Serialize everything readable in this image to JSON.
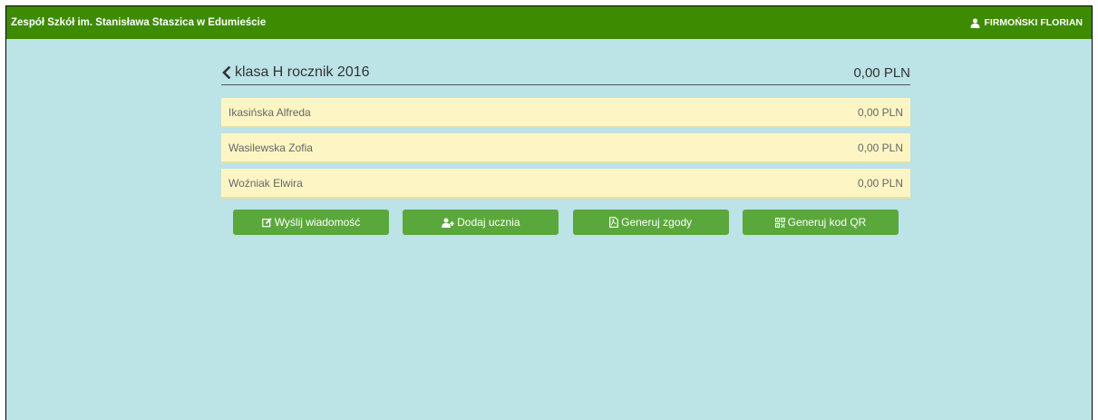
{
  "topbar": {
    "school_name": "Zespół Szkół im. Stanisława Staszica w Edumieście",
    "user_name": "FIRMOŃSKI FLORIAN"
  },
  "class_view": {
    "title": "klasa H rocznik 2016",
    "total": "0,00 PLN"
  },
  "students": [
    {
      "name": "Ikasińska Alfreda",
      "amount": "0,00 PLN"
    },
    {
      "name": "Wasilewska Zofia",
      "amount": "0,00 PLN"
    },
    {
      "name": "Woźniak Elwira",
      "amount": "0,00 PLN"
    }
  ],
  "actions": {
    "send_message": "Wyślij wiadomość",
    "add_student": "Dodaj ucznia",
    "generate_consents": "Generuj zgody",
    "generate_qr": "Generuj kod QR"
  },
  "colors": {
    "topbar": "#3d8b00",
    "background": "#bce3e6",
    "row": "#fdf6c4",
    "button": "#5aa83b"
  },
  "icons": {
    "user": "user-icon",
    "back": "chevron-left-icon",
    "send_message": "edit-icon",
    "add_student": "user-plus-icon",
    "generate_consents": "pdf-file-icon",
    "generate_qr": "qrcode-icon"
  }
}
